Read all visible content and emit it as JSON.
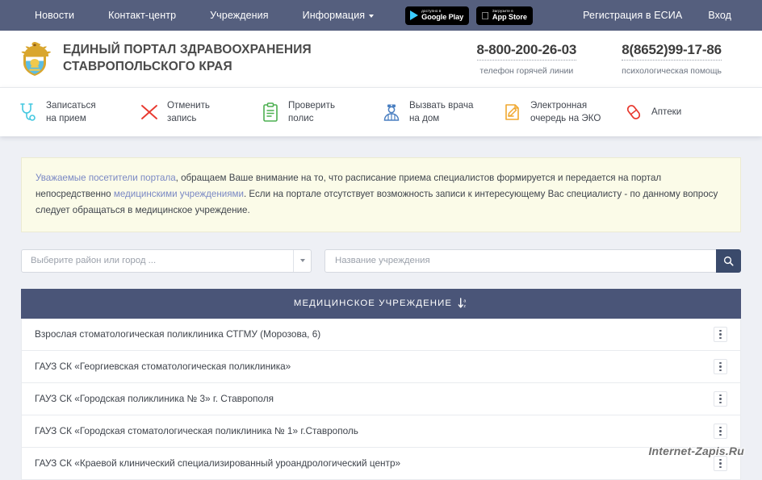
{
  "topnav": {
    "links": [
      {
        "label": "Новости",
        "icon": null
      },
      {
        "label": "Контакт-центр",
        "icon": null
      },
      {
        "label": "Учреждения",
        "icon": null
      },
      {
        "label": "Информация",
        "icon": "chevron-down-icon"
      }
    ],
    "badges": [
      {
        "small": "доступно в",
        "big": "Google Play",
        "icon": "google-play-icon"
      },
      {
        "small": "Загрузите в",
        "big": "App Store",
        "icon": "apple-icon"
      }
    ],
    "right_links": [
      {
        "label": "Регистрация в ЕСИА"
      },
      {
        "label": "Вход"
      }
    ],
    "background_color": "#555f7e"
  },
  "header": {
    "emblem_name": "stavropol-krai-coat-of-arms",
    "title_line1": "ЕДИНЫЙ ПОРТАЛ ЗДРАВООХРАНЕНИЯ",
    "title_line2": "СТАВРОПОЛЬСКОГО КРАЯ",
    "phones": [
      {
        "number": "8-800-200-26-03",
        "caption": "телефон горячей линии"
      },
      {
        "number": "8(8652)99-17-86",
        "caption": "психологическая помощь"
      }
    ]
  },
  "services": [
    {
      "icon": "stethoscope-icon",
      "color": "#45c8e0",
      "line1": "Записаться",
      "line2": "на прием"
    },
    {
      "icon": "cancel-x-icon",
      "color": "#e8392f",
      "line1": "Отменить",
      "line2": "запись"
    },
    {
      "icon": "clipboard-check-icon",
      "color": "#4caf50",
      "line1": "Проверить",
      "line2": "полис"
    },
    {
      "icon": "doctor-icon",
      "color": "#4a7fc1",
      "line1": "Вызвать врача",
      "line2": "на дом"
    },
    {
      "icon": "clipboard-pen-icon",
      "color": "#f0a830",
      "line1": "Электронная",
      "line2": "очередь на ЭКО"
    },
    {
      "icon": "pill-capsule-icon",
      "color": "#e8392f",
      "line1": "Аптеки",
      "line2": ""
    }
  ],
  "notice": {
    "highlight1": "Уважаемые посетители портала",
    "text1": ", обращаем Ваше внимание на то, что расписание приема специалистов формируется и передается на портал непосредственно ",
    "highlight2": "медицинскими учреждениями",
    "text2": ". Если на портале отсутствует возможность записи к интересующему Вас специалисту - по данному вопросу следует обращаться в медицинское учреждение.",
    "background_color": "#fbfbe8",
    "highlight_color": "#7a88c4"
  },
  "search": {
    "region_select_value": "Выберите район или город ...",
    "name_input_value": "",
    "name_input_placeholder": "Название учреждения",
    "search_icon": "magnifier-icon",
    "search_button_color": "#3a4a6b"
  },
  "table": {
    "header_label": "МЕДИЦИНСКОЕ УЧРЕЖДЕНИЕ",
    "sort_icon": "sort-az-descending-icon",
    "header_color": "#4a5578",
    "rows": [
      {
        "name": "Взрослая стоматологическая поликлиника СТГМУ (Морозова, 6)",
        "menu_icon": "kebab-menu-icon"
      },
      {
        "name": "ГАУЗ СК «Георгиевская стоматологическая поликлиника»",
        "menu_icon": "kebab-menu-icon"
      },
      {
        "name": "ГАУЗ СК «Городская поликлиника № 3» г. Ставрополя",
        "menu_icon": "kebab-menu-icon"
      },
      {
        "name": "ГАУЗ СК «Городская стоматологическая поликлиника № 1» г.Ставрополь",
        "menu_icon": "kebab-menu-icon"
      },
      {
        "name": "ГАУЗ СК «Краевой клинический специализированный уроандрологический центр»",
        "menu_icon": "kebab-menu-icon"
      }
    ]
  },
  "watermark": {
    "text": "Internet-Zapis.Ru"
  }
}
